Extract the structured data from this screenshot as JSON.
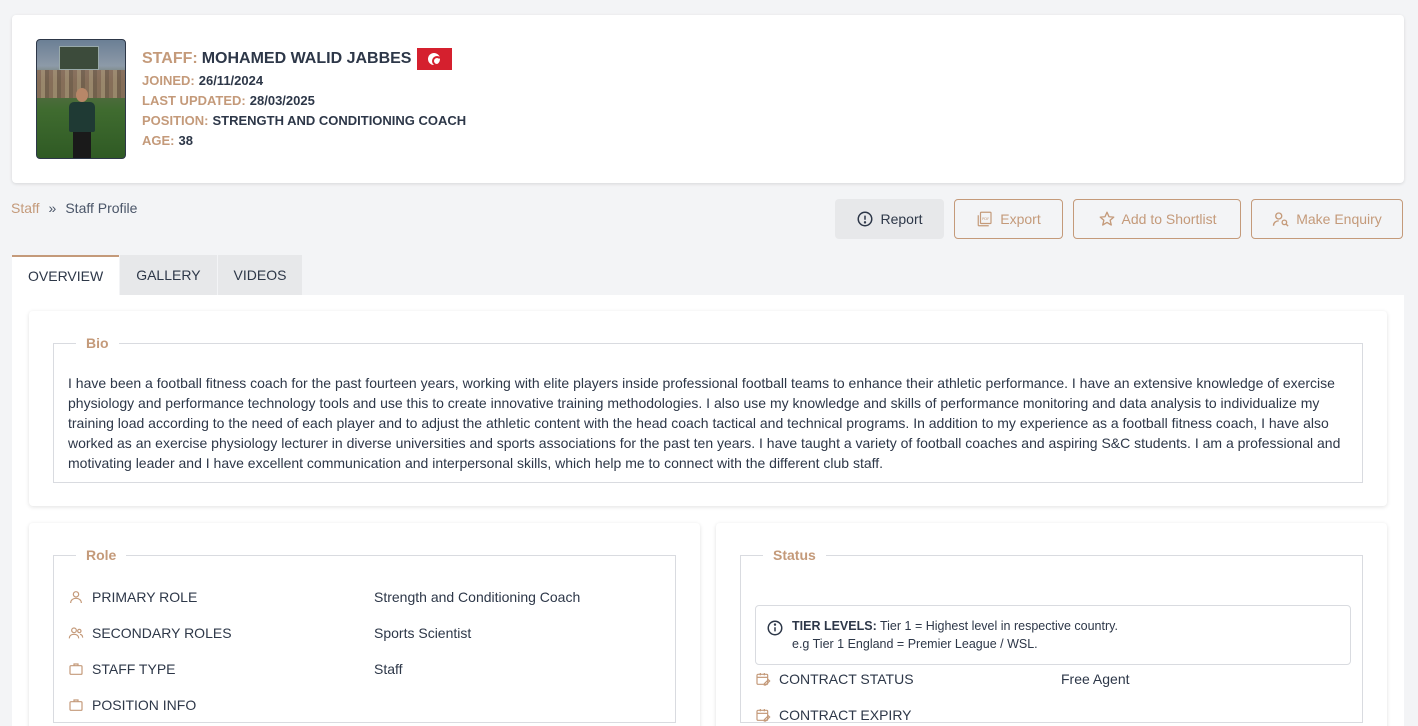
{
  "profile": {
    "staff_label": "STAFF:",
    "name": "MOHAMED WALID JABBES",
    "joined_label": "JOINED:",
    "joined": "26/11/2024",
    "updated_label": "LAST UPDATED:",
    "updated": "28/03/2025",
    "position_label": "POSITION:",
    "position": "STRENGTH AND CONDITIONING COACH",
    "age_label": "AGE:",
    "age": "38"
  },
  "breadcrumb": {
    "root": "Staff",
    "separator": "»",
    "current": "Staff Profile"
  },
  "actions": {
    "report": "Report",
    "export": "Export",
    "shortlist": "Add to Shortlist",
    "enquiry": "Make Enquiry"
  },
  "tabs": [
    "OVERVIEW",
    "GALLERY",
    "VIDEOS"
  ],
  "bio": {
    "title": "Bio",
    "text": "I have been a football fitness coach for the past fourteen years, working with elite players inside professional football teams to enhance their athletic performance. I have an extensive knowledge of exercise physiology and performance technology tools and use this to create innovative training methodologies. I also use my knowledge and skills of performance monitoring and data analysis to individualize my training load according to the need of each player and to adjust the athletic content with the head coach tactical and technical programs. In addition to my experience as a football fitness coach, I have also worked as an exercise physiology lecturer in diverse universities and sports associations for the past ten years. I have taught a variety of football coaches and aspiring S&C students. I am a professional and motivating leader and I have excellent communication and interpersonal skills, which help me to connect with the different club staff."
  },
  "role": {
    "title": "Role",
    "items": [
      {
        "key": "PRIMARY ROLE",
        "value": "Strength and Conditioning Coach",
        "icon": "user-icon"
      },
      {
        "key": "SECONDARY ROLES",
        "value": "Sports Scientist",
        "icon": "users-icon"
      },
      {
        "key": "STAFF TYPE",
        "value": "Staff",
        "icon": "briefcase-icon"
      },
      {
        "key": "POSITION INFO",
        "value": "",
        "icon": "briefcase-icon"
      }
    ]
  },
  "status": {
    "title": "Status",
    "tier_label": "TIER LEVELS:",
    "tier_line1": "Tier 1 = Highest level in respective country.",
    "tier_line2": "e.g Tier 1 England = Premier League / WSL.",
    "items": [
      {
        "key": "CONTRACT STATUS",
        "value": "Free Agent",
        "icon": "calendar-edit-icon"
      },
      {
        "key": "CONTRACT EXPIRY",
        "value": "",
        "icon": "calendar-edit-icon"
      }
    ]
  },
  "colors": {
    "accent": "#c49a7a",
    "text": "#2d3748",
    "flag_red": "#d5202e"
  }
}
